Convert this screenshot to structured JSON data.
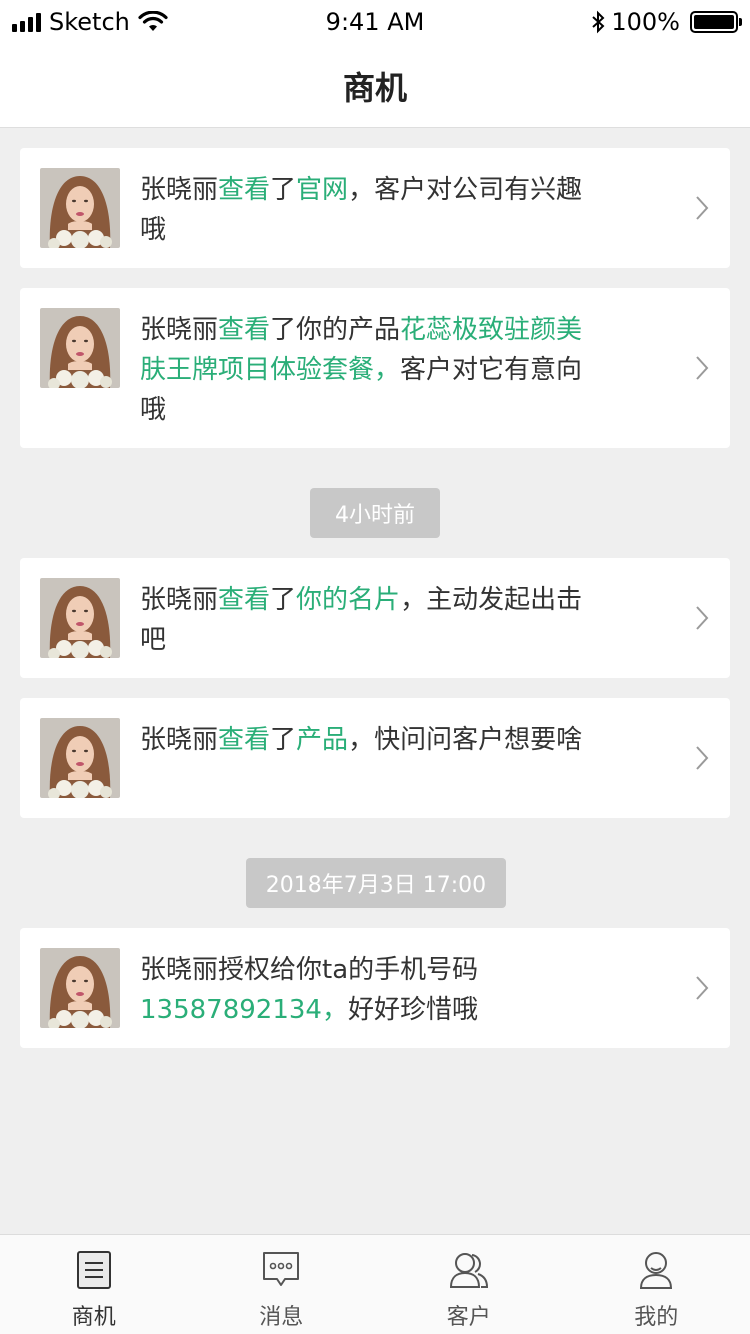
{
  "status_bar": {
    "carrier": "Sketch",
    "time": "9:41 AM",
    "battery": "100%"
  },
  "nav": {
    "title": "商机"
  },
  "feed": {
    "cards": [
      {
        "name": "张晓丽",
        "action": "查看",
        "mid": "了",
        "target": "官网",
        "rest": "，客户对公司有兴趣哦"
      },
      {
        "name": "张晓丽",
        "action": "查看",
        "mid": "了你的产品",
        "target": "花蕊极致驻颜美肤王牌项目体验套餐，",
        "rest": "客户对它有意向哦"
      },
      {
        "name": "张晓丽",
        "action": "查看",
        "mid": "了",
        "target": "你的名片",
        "rest": "，主动发起出击吧"
      },
      {
        "name": "张晓丽",
        "action": "查看",
        "mid": "了",
        "target": "产品",
        "rest": "，快问问客户想要啥"
      },
      {
        "name": "张晓丽",
        "action": "",
        "mid": "授权给你ta的手机号码",
        "target": "13587892134，",
        "rest": "好好珍惜哦"
      }
    ],
    "time_labels": [
      "4小时前",
      "2018年7月3日 17:00"
    ]
  },
  "tab_bar": {
    "tabs": [
      {
        "label": "商机",
        "icon": "list-icon"
      },
      {
        "label": "消息",
        "icon": "message-icon"
      },
      {
        "label": "客户",
        "icon": "customers-icon"
      },
      {
        "label": "我的",
        "icon": "profile-icon"
      }
    ],
    "active_index": 0
  },
  "colors": {
    "accent": "#2aae78",
    "background": "#efefef",
    "pill": "#c8c8c8"
  }
}
